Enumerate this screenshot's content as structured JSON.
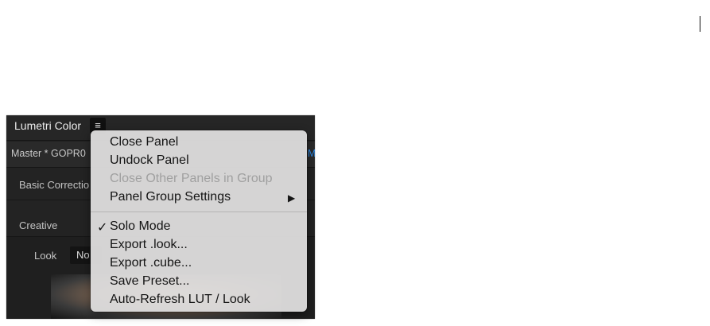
{
  "panel": {
    "title": "Lumetri Color",
    "menu_icon": "hamburger-menu-icon",
    "clip_label": "Master * GOPR0",
    "clip_accent": "M",
    "sections": {
      "basic": "Basic Correctio",
      "creative": "Creative"
    },
    "look": {
      "label": "Look",
      "value": "No"
    }
  },
  "menu": {
    "items": [
      {
        "label": "Close Panel",
        "enabled": true
      },
      {
        "label": "Undock Panel",
        "enabled": true
      },
      {
        "label": "Close Other Panels in Group",
        "enabled": false
      },
      {
        "label": "Panel Group Settings",
        "enabled": true,
        "submenu_icon": "submenu-arrow-icon"
      },
      {
        "label": "Solo Mode",
        "enabled": true,
        "checked": true,
        "check_icon": "checkmark-icon"
      },
      {
        "label": "Export .look...",
        "enabled": true
      },
      {
        "label": "Export .cube...",
        "enabled": true
      },
      {
        "label": "Save Preset...",
        "enabled": true
      },
      {
        "label": "Auto-Refresh LUT / Look",
        "enabled": true
      }
    ]
  },
  "colors": {
    "panel_bg": "#1f1f1f",
    "menu_bg": "#dddcdc",
    "accent": "#2d8ceb",
    "disabled_text": "#a0a0a0"
  }
}
